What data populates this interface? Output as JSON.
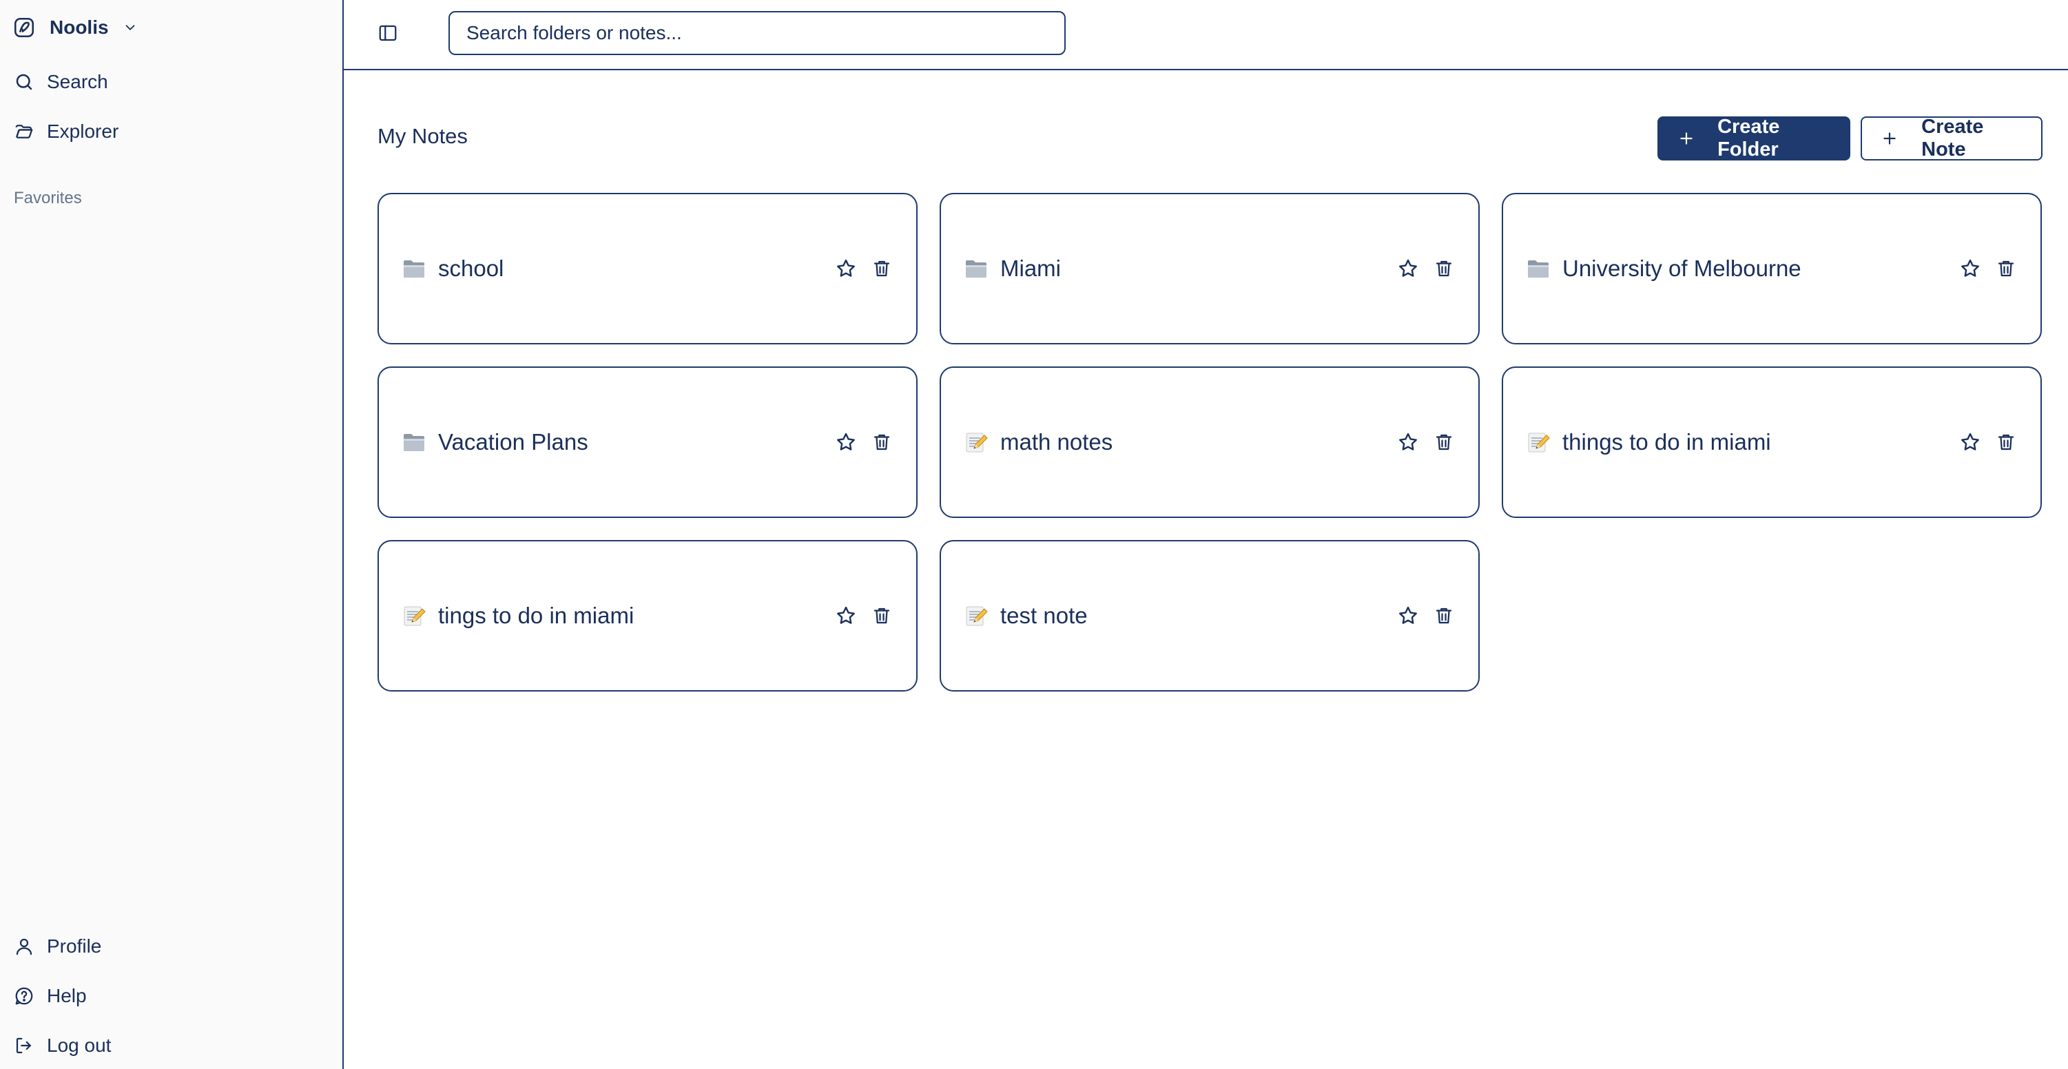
{
  "app": {
    "name": "Noolis"
  },
  "sidebar": {
    "nav": [
      {
        "label": "Search",
        "icon": "search-icon"
      },
      {
        "label": "Explorer",
        "icon": "folder-open-icon"
      }
    ],
    "favorites_label": "Favorites",
    "bottom": [
      {
        "label": "Profile",
        "icon": "user-icon"
      },
      {
        "label": "Help",
        "icon": "help-icon"
      },
      {
        "label": "Log out",
        "icon": "logout-icon"
      }
    ]
  },
  "topbar": {
    "search_placeholder": "Search folders or notes..."
  },
  "main": {
    "title": "My Notes",
    "create_folder_label": "Create Folder",
    "create_note_label": "Create Note",
    "items": [
      {
        "type": "folder",
        "title": "school"
      },
      {
        "type": "folder",
        "title": "Miami"
      },
      {
        "type": "folder",
        "title": "University of Melbourne"
      },
      {
        "type": "folder",
        "title": "Vacation Plans"
      },
      {
        "type": "note",
        "title": "math notes"
      },
      {
        "type": "note",
        "title": "things to do in miami"
      },
      {
        "type": "note",
        "title": "tings to do in miami"
      },
      {
        "type": "note",
        "title": "test note"
      }
    ]
  },
  "colors": {
    "primary": "#1e3a6e",
    "text": "#1a2f5a",
    "muted": "#64748b",
    "sidebar_bg": "#fafafa"
  }
}
